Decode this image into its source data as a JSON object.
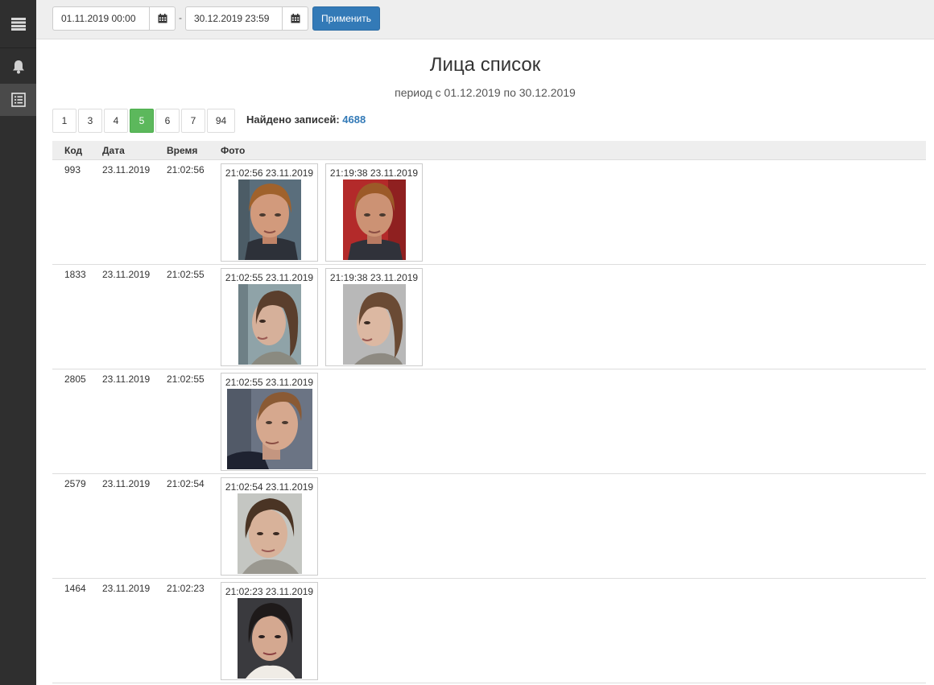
{
  "toolbar": {
    "date_from": "01.11.2019 00:00",
    "date_to": "30.12.2019 23:59",
    "separator": "-",
    "apply_label": "Применить"
  },
  "page": {
    "title": "Лица список",
    "subtitle": "период с 01.12.2019 по 30.12.2019"
  },
  "pagination": {
    "pages": [
      "1",
      "3",
      "4",
      "5",
      "6",
      "7",
      "94"
    ],
    "current": "5",
    "found_label": "Найдено записей:",
    "found_count": "4688"
  },
  "table": {
    "headers": {
      "code": "Код",
      "date": "Дата",
      "time": "Время",
      "photo": "Фото"
    },
    "rows": [
      {
        "code": "993",
        "date": "23.11.2019",
        "time": "21:02:56",
        "photos": [
          {
            "caption": "21:02:56 23.11.2019"
          },
          {
            "caption": "21:19:38 23.11.2019"
          }
        ]
      },
      {
        "code": "1833",
        "date": "23.11.2019",
        "time": "21:02:55",
        "photos": [
          {
            "caption": "21:02:55 23.11.2019"
          },
          {
            "caption": "21:19:38 23.11.2019"
          }
        ]
      },
      {
        "code": "2805",
        "date": "23.11.2019",
        "time": "21:02:55",
        "photos": [
          {
            "caption": "21:02:55 23.11.2019"
          }
        ]
      },
      {
        "code": "2579",
        "date": "23.11.2019",
        "time": "21:02:54",
        "photos": [
          {
            "caption": "21:02:54 23.11.2019"
          }
        ]
      },
      {
        "code": "1464",
        "date": "23.11.2019",
        "time": "21:02:23",
        "photos": [
          {
            "caption": "21:02:23 23.11.2019"
          }
        ]
      }
    ]
  },
  "colors": {
    "sidebar_bg": "#2f2f2f",
    "primary": "#337ab7",
    "active_page": "#5cb85c"
  }
}
